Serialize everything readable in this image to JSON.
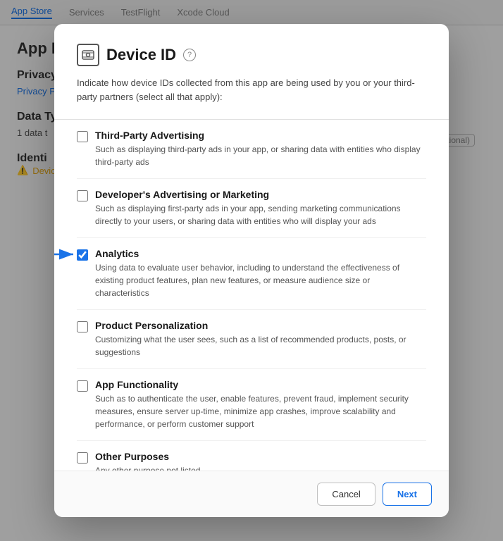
{
  "nav": {
    "items": [
      {
        "label": "App Store",
        "active": true
      },
      {
        "label": "Services",
        "active": false
      },
      {
        "label": "TestFlight",
        "active": false
      },
      {
        "label": "Xcode Cloud",
        "active": false
      }
    ]
  },
  "background": {
    "section_title": "App Pr",
    "privacy_label": "Privacy",
    "privacy_link": "Privacy Poli",
    "optional_badge": "(Optional)",
    "data_types_title": "Data Ty",
    "data_types_desc": "1 data t",
    "identity_title": "Identi",
    "device_label": "Device I"
  },
  "modal": {
    "icon_symbol": "👤",
    "title": "Device ID",
    "help_label": "?",
    "description": "Indicate how device IDs collected from this app are being used by you or your third-party partners (select all that apply):",
    "checkboxes": [
      {
        "id": "third-party-advertising",
        "label": "Third-Party Advertising",
        "description": "Such as displaying third-party ads in your app, or sharing data with entities who display third-party ads",
        "checked": false
      },
      {
        "id": "developers-advertising",
        "label": "Developer's Advertising or Marketing",
        "description": "Such as displaying first-party ads in your app, sending marketing communications directly to your users, or sharing data with entities who will display your ads",
        "checked": false
      },
      {
        "id": "analytics",
        "label": "Analytics",
        "description": "Using data to evaluate user behavior, including to understand the effectiveness of existing product features, plan new features, or measure audience size or characteristics",
        "checked": true
      },
      {
        "id": "product-personalization",
        "label": "Product Personalization",
        "description": "Customizing what the user sees, such as a list of recommended products, posts, or suggestions",
        "checked": false
      },
      {
        "id": "app-functionality",
        "label": "App Functionality",
        "description": "Such as to authenticate the user, enable features, prevent fraud, implement security measures, ensure server up-time, minimize app crashes, improve scalability and performance, or perform customer support",
        "checked": false
      },
      {
        "id": "other-purposes",
        "label": "Other Purposes",
        "description": "Any other purpose not listed",
        "checked": false
      }
    ],
    "footer": {
      "cancel_label": "Cancel",
      "next_label": "Next"
    }
  }
}
